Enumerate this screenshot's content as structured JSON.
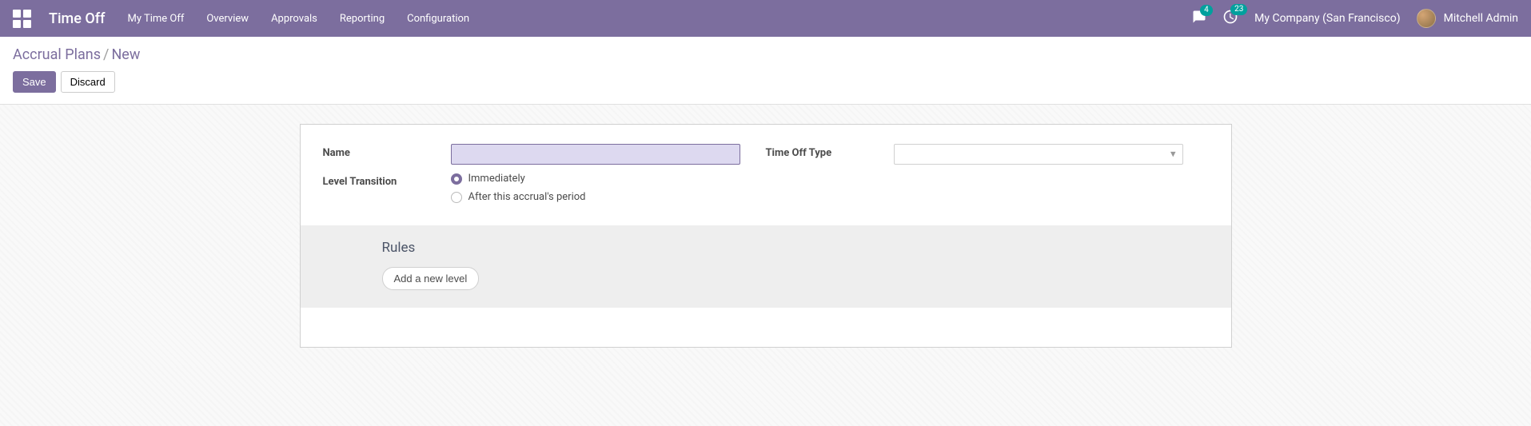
{
  "header": {
    "app_title": "Time Off",
    "menu": [
      "My Time Off",
      "Overview",
      "Approvals",
      "Reporting",
      "Configuration"
    ],
    "messages_badge": "4",
    "activities_badge": "23",
    "company": "My Company (San Francisco)",
    "user": "Mitchell Admin"
  },
  "breadcrumb": {
    "parent": "Accrual Plans",
    "current": "New"
  },
  "buttons": {
    "save": "Save",
    "discard": "Discard"
  },
  "form": {
    "name_label": "Name",
    "name_value": "",
    "type_label": "Time Off Type",
    "type_value": "",
    "transition_label": "Level Transition",
    "transition_options": {
      "immediately": "Immediately",
      "after_period": "After this accrual's period"
    },
    "transition_selected": "immediately"
  },
  "rules": {
    "title": "Rules",
    "add_label": "Add a new level"
  }
}
